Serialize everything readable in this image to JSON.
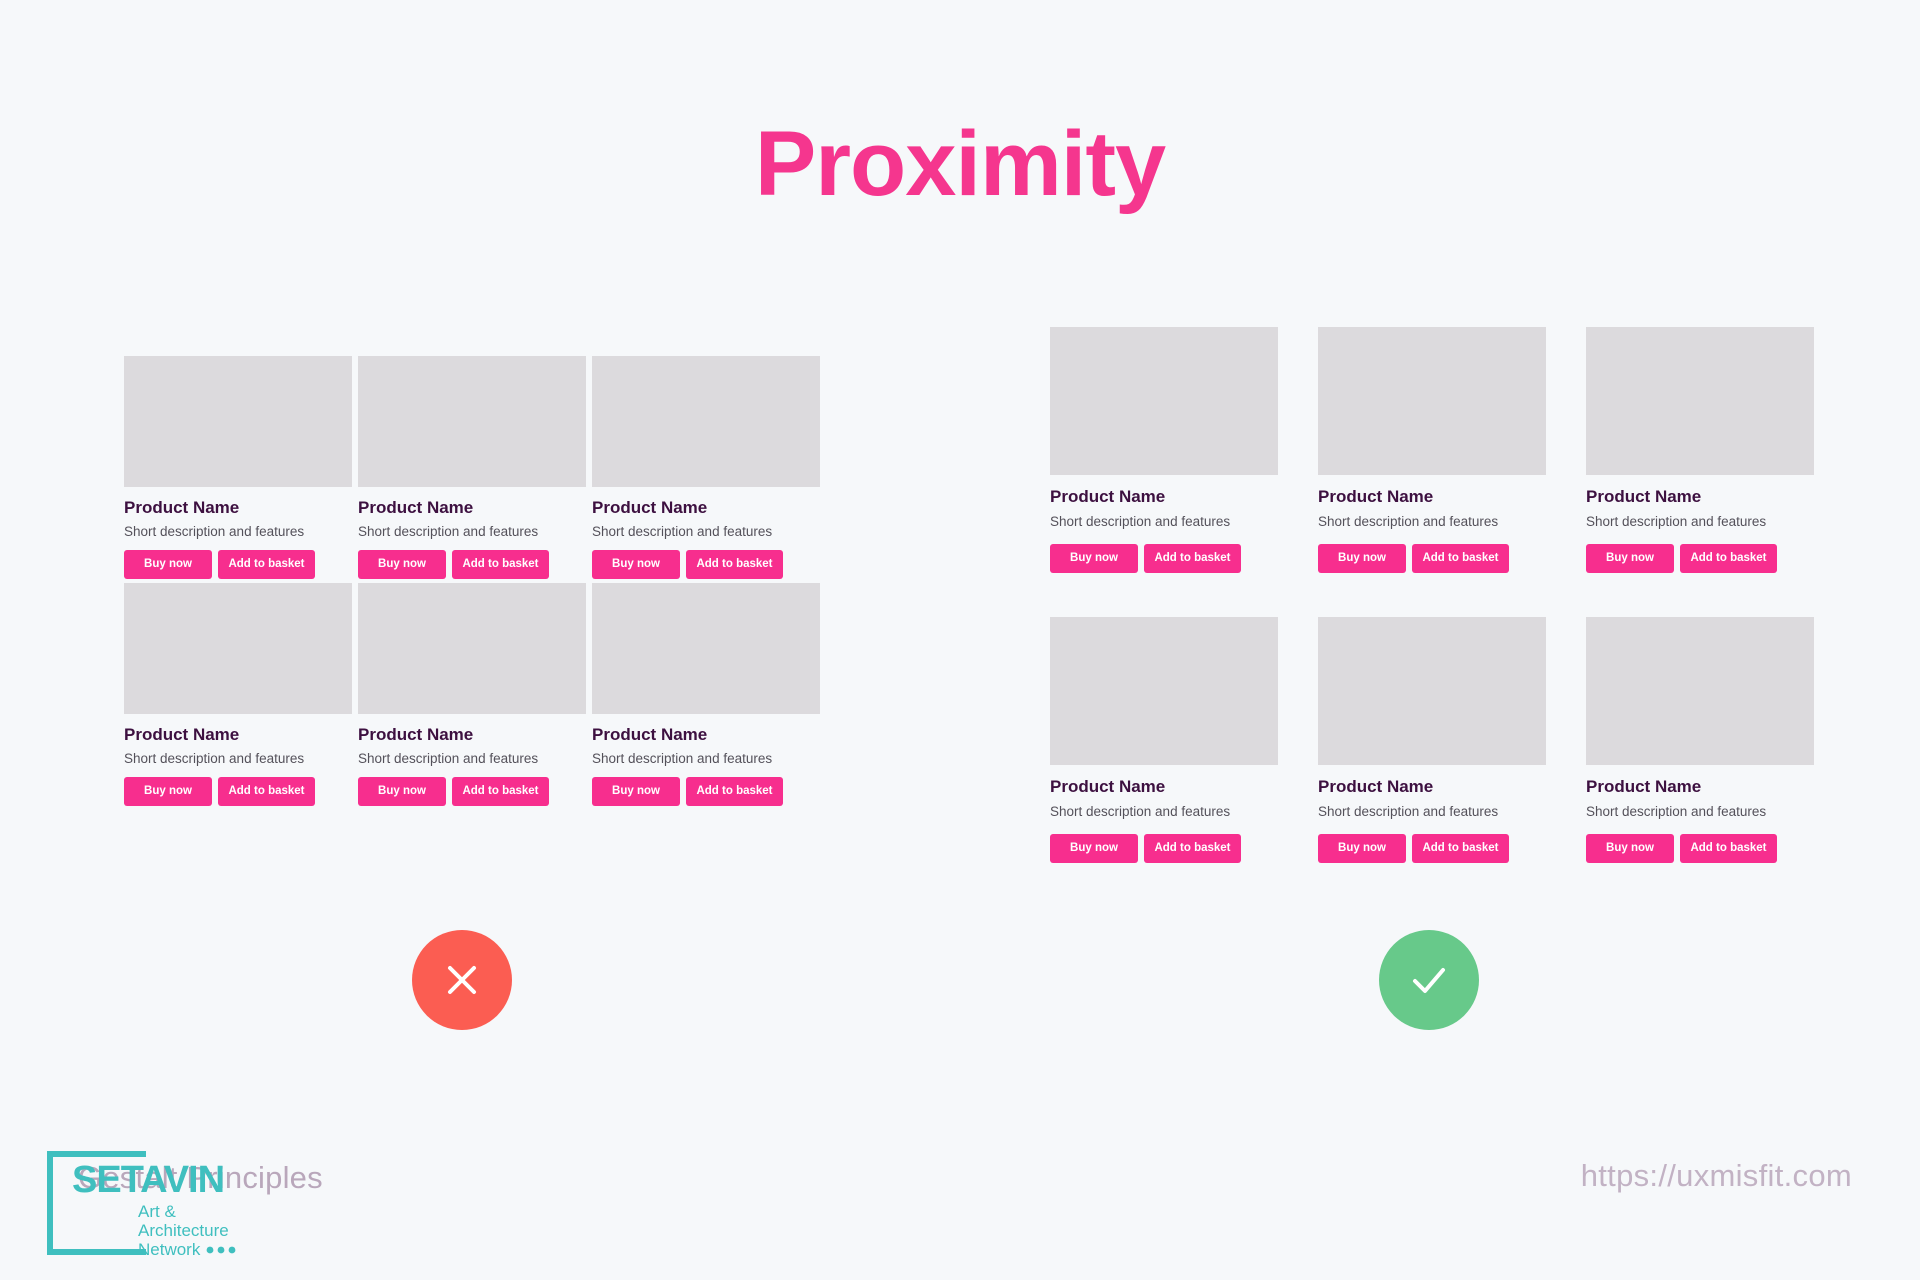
{
  "page": {
    "title": "Proximity",
    "background_color": "#f6f8fa",
    "accent_color": "#f5368e"
  },
  "product_card": {
    "name": "Product Name",
    "description": "Short description and features",
    "buy_label": "Buy now",
    "basket_label": "Add to basket",
    "button_color": "#f72e8e",
    "thumb_color": "#dcdadd",
    "name_color": "#3d1040"
  },
  "examples": {
    "bad": {
      "verdict_icon": "close-icon",
      "verdict_color": "#fb5d52",
      "columns": 3,
      "rows": 2,
      "cards": [
        {
          "name": "Product Name",
          "description": "Short description and features",
          "buy_label": "Buy now",
          "basket_label": "Add to basket"
        },
        {
          "name": "Product Name",
          "description": "Short description and features",
          "buy_label": "Buy now",
          "basket_label": "Add to basket"
        },
        {
          "name": "Product Name",
          "description": "Short description and features",
          "buy_label": "Buy now",
          "basket_label": "Add to basket"
        },
        {
          "name": "Product Name",
          "description": "Short description and features",
          "buy_label": "Buy now",
          "basket_label": "Add to basket"
        },
        {
          "name": "Product Name",
          "description": "Short description and features",
          "buy_label": "Buy now",
          "basket_label": "Add to basket"
        },
        {
          "name": "Product Name",
          "description": "Short description and features",
          "buy_label": "Buy now",
          "basket_label": "Add to basket"
        }
      ]
    },
    "good": {
      "verdict_icon": "check-icon",
      "verdict_color": "#67c98a",
      "columns": 3,
      "rows": 2,
      "cards": [
        {
          "name": "Product Name",
          "description": "Short description and features",
          "buy_label": "Buy now",
          "basket_label": "Add to basket"
        },
        {
          "name": "Product Name",
          "description": "Short description and features",
          "buy_label": "Buy now",
          "basket_label": "Add to basket"
        },
        {
          "name": "Product Name",
          "description": "Short description and features",
          "buy_label": "Buy now",
          "basket_label": "Add to basket"
        },
        {
          "name": "Product Name",
          "description": "Short description and features",
          "buy_label": "Buy now",
          "basket_label": "Add to basket"
        },
        {
          "name": "Product Name",
          "description": "Short description and features",
          "buy_label": "Buy now",
          "basket_label": "Add to basket"
        },
        {
          "name": "Product Name",
          "description": "Short description and features",
          "buy_label": "Buy now",
          "basket_label": "Add to basket"
        }
      ]
    }
  },
  "footer": {
    "caption": "Gestalt Principles",
    "url": "https://uxmisfit.com",
    "caption_color": "#b9a7bb"
  },
  "logo": {
    "wordmark": "SETAVIN",
    "line1": "Art &",
    "line2": "Architecture",
    "line3": "Network",
    "color": "#3fbfbf"
  }
}
